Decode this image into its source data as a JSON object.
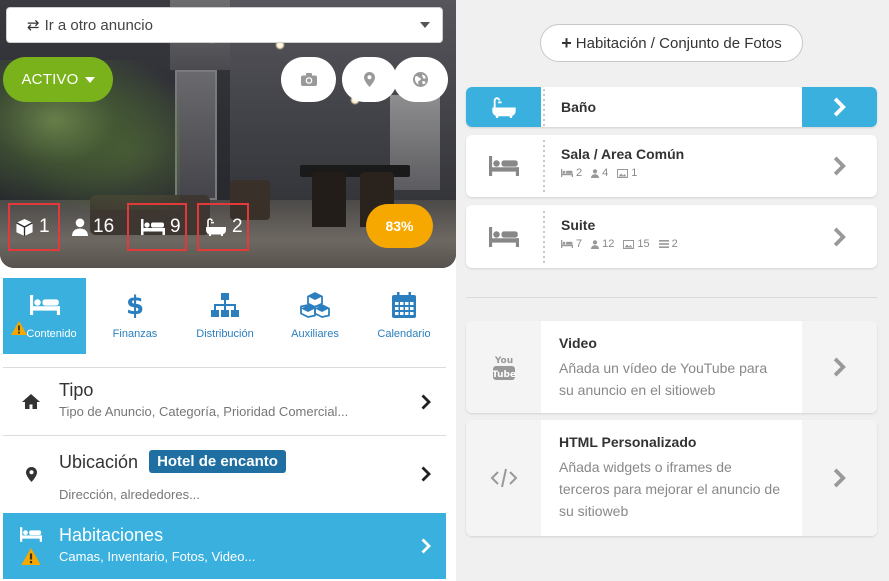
{
  "listing_selector": {
    "label": "Ir a otro anuncio"
  },
  "status": {
    "label": "ACTIVO",
    "color": "#7ab21c"
  },
  "stats": {
    "inventory": "1",
    "guests": "16",
    "beds": "9",
    "baths": "2"
  },
  "completion": {
    "label": "83%",
    "color": "#f6a700"
  },
  "tabs": [
    {
      "label": "Contenido"
    },
    {
      "label": "Finanzas"
    },
    {
      "label": "Distribución"
    },
    {
      "label": "Auxiliares"
    },
    {
      "label": "Calendario"
    }
  ],
  "menu": {
    "tipo": {
      "title": "Tipo",
      "subtitle": "Tipo de Anuncio, Categoría, Prioridad Comercial..."
    },
    "ubicacion": {
      "title": "Ubicación",
      "badge": "Hotel de encanto",
      "subtitle": "Dirección, alrededores..."
    },
    "habitaciones": {
      "title": "Habitaciones",
      "subtitle": "Camas, Inventario, Fotos, Video..."
    }
  },
  "right": {
    "add_button": "Habitación / Conjunto de Fotos",
    "rooms": [
      {
        "title": "Baño"
      },
      {
        "title": "Sala / Area Común",
        "beds": "2",
        "guests": "4",
        "photos": "1"
      },
      {
        "title": "Suite",
        "beds": "7",
        "guests": "12",
        "photos": "15",
        "items": "2"
      }
    ],
    "features": [
      {
        "title": "Video",
        "description": "Añada un vídeo de YouTube para su anuncio en el sitioweb"
      },
      {
        "title": "HTML Personalizado",
        "description": "Añada widgets o iframes de terceros para mejorar el anuncio de su sitioweb"
      }
    ]
  },
  "colors": {
    "accent": "#3ab0de",
    "tab_text": "#2b7fbf",
    "badge": "#1f6fa3",
    "highlight_border": "#e23a3a"
  }
}
